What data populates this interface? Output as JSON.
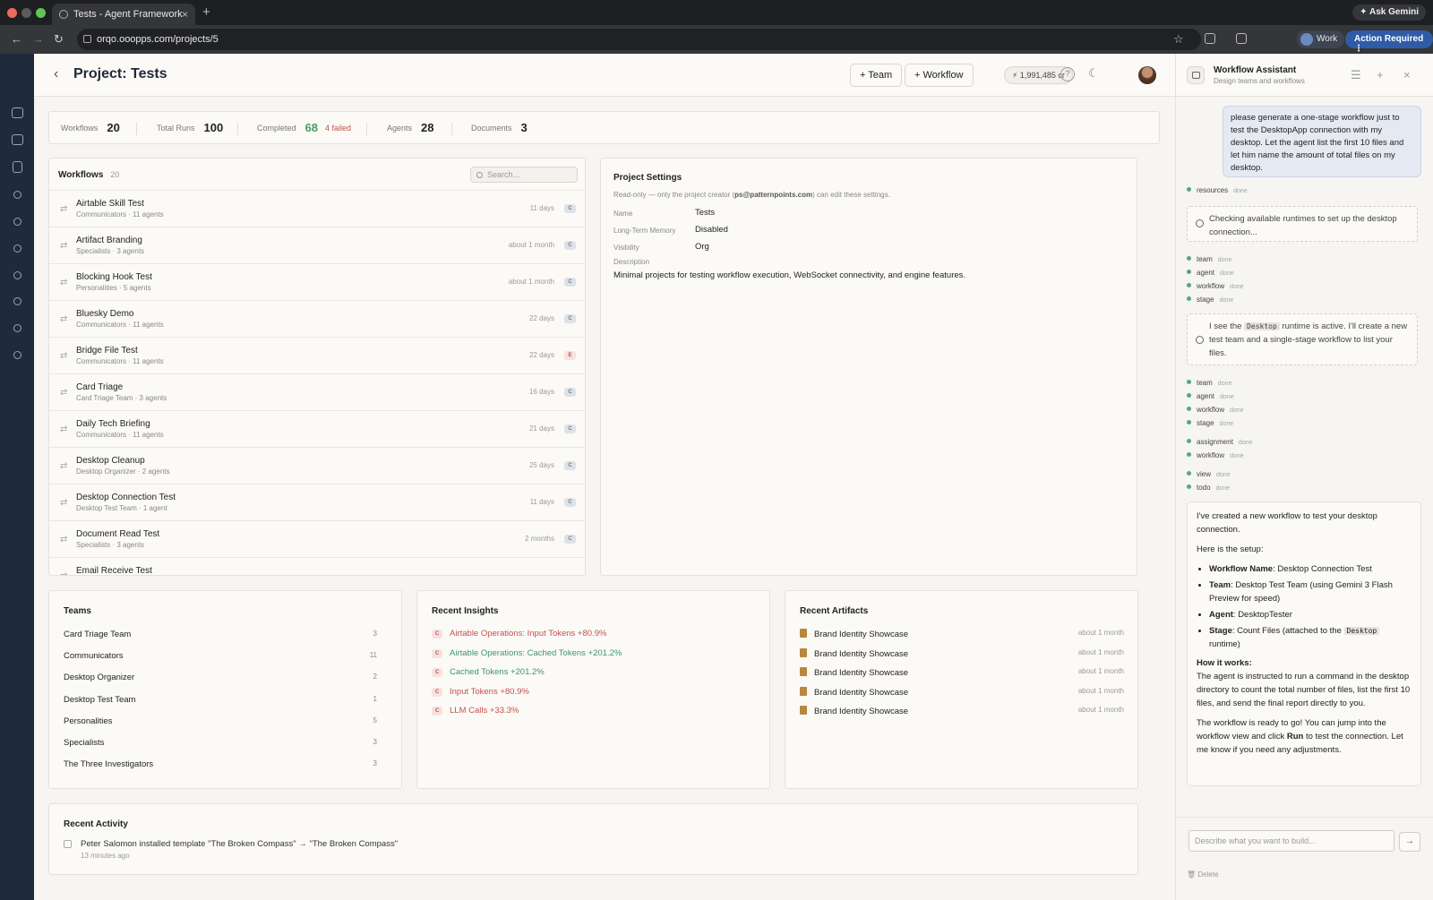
{
  "browser": {
    "tab_title": "Tests - Agent Framework",
    "url": "orqo.ooopps.com/projects/5",
    "ask_gemini": "Ask Gemini",
    "profile": "Work",
    "action_required": "Action Required"
  },
  "header": {
    "title": "Project: Tests",
    "team_btn": "+ Team",
    "workflow_btn": "+ Workflow",
    "credits": "1,991,485 cr"
  },
  "stats": {
    "workflows_label": "Workflows",
    "workflows": "20",
    "runs_label": "Total Runs",
    "runs": "100",
    "completed_label": "Completed",
    "completed": "68",
    "failed": "4 failed",
    "agents_label": "Agents",
    "agents": "28",
    "docs_label": "Documents",
    "docs": "3"
  },
  "workflows": {
    "title": "Workflows",
    "count": "20",
    "search_placeholder": "Search...",
    "items": [
      {
        "name": "Airtable Skill Test",
        "sub": "Communicators · 11 agents",
        "date": "11 days",
        "badge": "C"
      },
      {
        "name": "Artifact Branding",
        "sub": "Specialists · 3 agents",
        "date": "about 1 month",
        "badge": "C"
      },
      {
        "name": "Blocking Hook Test",
        "sub": "Personalities · 5 agents",
        "date": "about 1 month",
        "badge": "C"
      },
      {
        "name": "Bluesky Demo",
        "sub": "Communicators · 11 agents",
        "date": "22 days",
        "badge": "C"
      },
      {
        "name": "Bridge File Test",
        "sub": "Communicators · 11 agents",
        "date": "22 days",
        "badge": "E"
      },
      {
        "name": "Card Triage",
        "sub": "Card Triage Team · 3 agents",
        "date": "16 days",
        "badge": "C"
      },
      {
        "name": "Daily Tech Briefing",
        "sub": "Communicators · 11 agents",
        "date": "21 days",
        "badge": "C"
      },
      {
        "name": "Desktop Cleanup",
        "sub": "Desktop Organizer · 2 agents",
        "date": "25 days",
        "badge": "C"
      },
      {
        "name": "Desktop Connection Test",
        "sub": "Desktop Test Team · 1 agent",
        "date": "11 days",
        "badge": "C"
      },
      {
        "name": "Document Read Test",
        "sub": "Specialists · 3 agents",
        "date": "2 months",
        "badge": "C"
      },
      {
        "name": "Email Receive Test",
        "sub": "",
        "date": "",
        "badge": ""
      }
    ]
  },
  "settings": {
    "title": "Project Settings",
    "note_pre": "Read-only — only the project creator (",
    "note_email": "ps@patternpoints.com",
    "note_post": ") can edit these settings.",
    "name_label": "Name",
    "name": "Tests",
    "memory_label": "Long-Term Memory",
    "memory": "Disabled",
    "visibility_label": "Visibility",
    "visibility": "Org",
    "desc_label": "Description",
    "desc": "Minimal projects for testing workflow execution, WebSocket connectivity, and engine features."
  },
  "teams": {
    "title": "Teams",
    "items": [
      {
        "name": "Card Triage Team",
        "count": "3"
      },
      {
        "name": "Communicators",
        "count": "11"
      },
      {
        "name": "Desktop Organizer",
        "count": "2"
      },
      {
        "name": "Desktop Test Team",
        "count": "1"
      },
      {
        "name": "Personalities",
        "count": "5"
      },
      {
        "name": "Specialists",
        "count": "3"
      },
      {
        "name": "The Three Investigators",
        "count": "3"
      }
    ]
  },
  "insights": {
    "title": "Recent Insights",
    "items": [
      {
        "text": "Airtable Operations: Input Tokens +80.9%",
        "color": "#c6514b"
      },
      {
        "text": "Airtable Operations: Cached Tokens +201.2%",
        "color": "#3f9468"
      },
      {
        "text": "Cached Tokens +201.2%",
        "color": "#3f9468"
      },
      {
        "text": "Input Tokens +80.9%",
        "color": "#c6514b"
      },
      {
        "text": "LLM Calls +33.3%",
        "color": "#c6514b"
      }
    ],
    "badge": "C"
  },
  "artifacts": {
    "title": "Recent Artifacts",
    "items": [
      {
        "name": "Brand Identity Showcase",
        "date": "about 1 month"
      },
      {
        "name": "Brand Identity Showcase",
        "date": "about 1 month"
      },
      {
        "name": "Brand Identity Showcase",
        "date": "about 1 month"
      },
      {
        "name": "Brand Identity Showcase",
        "date": "about 1 month"
      },
      {
        "name": "Brand Identity Showcase",
        "date": "about 1 month"
      }
    ]
  },
  "activity": {
    "title": "Recent Activity",
    "text": "Peter Salomon installed template \"The Broken Compass\" → \"The Broken Compass\"",
    "time": "13 minutes ago"
  },
  "assistant": {
    "title": "Workflow Assistant",
    "subtitle": "Design teams and workflows",
    "user_msg": "please generate a one-stage workflow just to test the DesktopApp connection with my desktop. Let the agent list the first 10 files and let him name the amount of total files on my desktop.",
    "done": "done",
    "info1": "Checking available runtimes to set up the desktop connection...",
    "info2_pre": "I see the ",
    "info2_code": "Desktop",
    "info2_post": " runtime is active. I'll create a new test team and a single-stage workflow to list your files.",
    "steps": {
      "resources": "resources",
      "team": "team",
      "agent": "agent",
      "workflow": "workflow",
      "stage": "stage",
      "assignment": "assignment",
      "view": "view",
      "todo": "todo"
    },
    "reply": {
      "intro": "I've created a new workflow to test your desktop connection.",
      "setup": "Here is the setup:",
      "wf_k": "Workflow Name",
      "wf_v": ": Desktop Connection Test",
      "team_k": "Team",
      "team_v": ": Desktop Test Team (using Gemini 3 Flash Preview for speed)",
      "agent_k": "Agent",
      "agent_v": ": DesktopTester",
      "stage_k": "Stage",
      "stage_v": ": Count Files (attached to the ",
      "stage_code": "Desktop",
      "stage_end": " runtime)",
      "how": "How it works:",
      "how_text": "The agent is instructed to run a command in the desktop directory to count the total number of files, list the first 10 files, and send the final report directly to you.",
      "ready_pre": "The workflow is ready to go! You can jump into the workflow view and click ",
      "ready_run": "Run",
      "ready_post": " to test the connection. Let me know if you need any adjustments."
    },
    "input_placeholder": "Describe what you want to build...",
    "delete": "Delete"
  }
}
